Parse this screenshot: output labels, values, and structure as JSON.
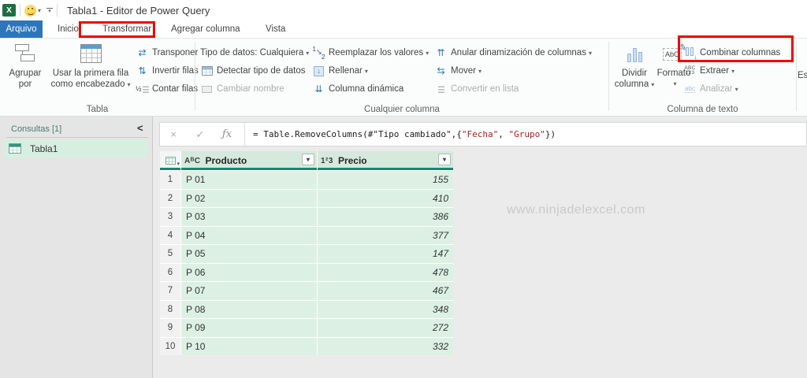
{
  "title_bar": {
    "title": "Tabla1 - Editor de Power Query"
  },
  "tabs": {
    "arquivo": "Arquivo",
    "inicio": "Inicio",
    "transformar": "Transformar",
    "agregar": "Agregar columna",
    "vista": "Vista"
  },
  "ribbon": {
    "tabla": {
      "label": "Tabla",
      "agrupar_l1": "Agrupar",
      "agrupar_l2": "por",
      "usar_l1": "Usar la primera fila",
      "usar_l2": "como encabezado",
      "transponer": "Transponer",
      "invertir": "Invertir filas",
      "contar": "Contar filas"
    },
    "cualquier": {
      "label": "Cualquier columna",
      "tipo": "Tipo de datos: Cualquiera",
      "detectar": "Detectar tipo de datos",
      "cambiar": "Cambiar nombre",
      "reemplazar": "Reemplazar los valores",
      "rellenar": "Rellenar",
      "dinamica": "Columna dinámica",
      "anular": "Anular dinamización de columnas",
      "mover": "Mover",
      "convertir": "Convertir en lista"
    },
    "texto": {
      "label": "Columna de texto",
      "dividir_l1": "Dividir",
      "dividir_l2": "columna",
      "formato": "Formato",
      "combinar": "Combinar columnas",
      "extraer": "Extraer",
      "analizar": "Analizar"
    },
    "partial": {
      "estadisticas_partial": "Esta"
    }
  },
  "sidebar": {
    "header": "Consultas [1]",
    "query": "Tabla1"
  },
  "formula": {
    "p1": "= Table.RemoveColumns(#\"Tipo cambiado\",{",
    "s1": "\"Fecha\"",
    "p2": ", ",
    "s2": "\"Grupo\"",
    "p3": "})"
  },
  "grid": {
    "columns": [
      {
        "type": "AᴮC",
        "name": "Producto"
      },
      {
        "type": "1²3",
        "name": "Precio"
      }
    ],
    "rows": [
      {
        "n": "1",
        "producto": "P 01",
        "precio": "155"
      },
      {
        "n": "2",
        "producto": "P 02",
        "precio": "410"
      },
      {
        "n": "3",
        "producto": "P 03",
        "precio": "386"
      },
      {
        "n": "4",
        "producto": "P 04",
        "precio": "377"
      },
      {
        "n": "5",
        "producto": "P 05",
        "precio": "147"
      },
      {
        "n": "6",
        "producto": "P 06",
        "precio": "478"
      },
      {
        "n": "7",
        "producto": "P 07",
        "precio": "467"
      },
      {
        "n": "8",
        "producto": "P 08",
        "precio": "348"
      },
      {
        "n": "9",
        "producto": "P 09",
        "precio": "272"
      },
      {
        "n": "10",
        "producto": "P 10",
        "precio": "332"
      }
    ]
  },
  "watermark": "www.ninjadelexcel.com",
  "icons": {
    "caret": "▾",
    "collapse": "<",
    "close": "×",
    "check": "✓",
    "fx": "ƒx",
    "excel_x": "X",
    "transponer": "⇄",
    "invertir": "⇅",
    "contar_half": "½",
    "reemplazar_1": "1",
    "reemplazar_2": "2",
    "reemplazar_arrow": "↘",
    "rellenar": "↓",
    "dinamica": "⇊",
    "anular": "⇈",
    "mover": "⇆",
    "extraer_top": "ABC",
    "extraer_bottom": "123",
    "analizar": "abc",
    "merge_arrow": "↓",
    "formato_abc": "AbC",
    "formato_pen": "✎"
  },
  "colors": {
    "accent_teal": "#0f8a70",
    "row_green": "#dcf1e4",
    "header_green": "#d5e9dd",
    "tab_blue": "#2e76ba",
    "selected_green": "#d7efe1",
    "red_box": "#f20000",
    "string_red": "#b01e1e"
  }
}
